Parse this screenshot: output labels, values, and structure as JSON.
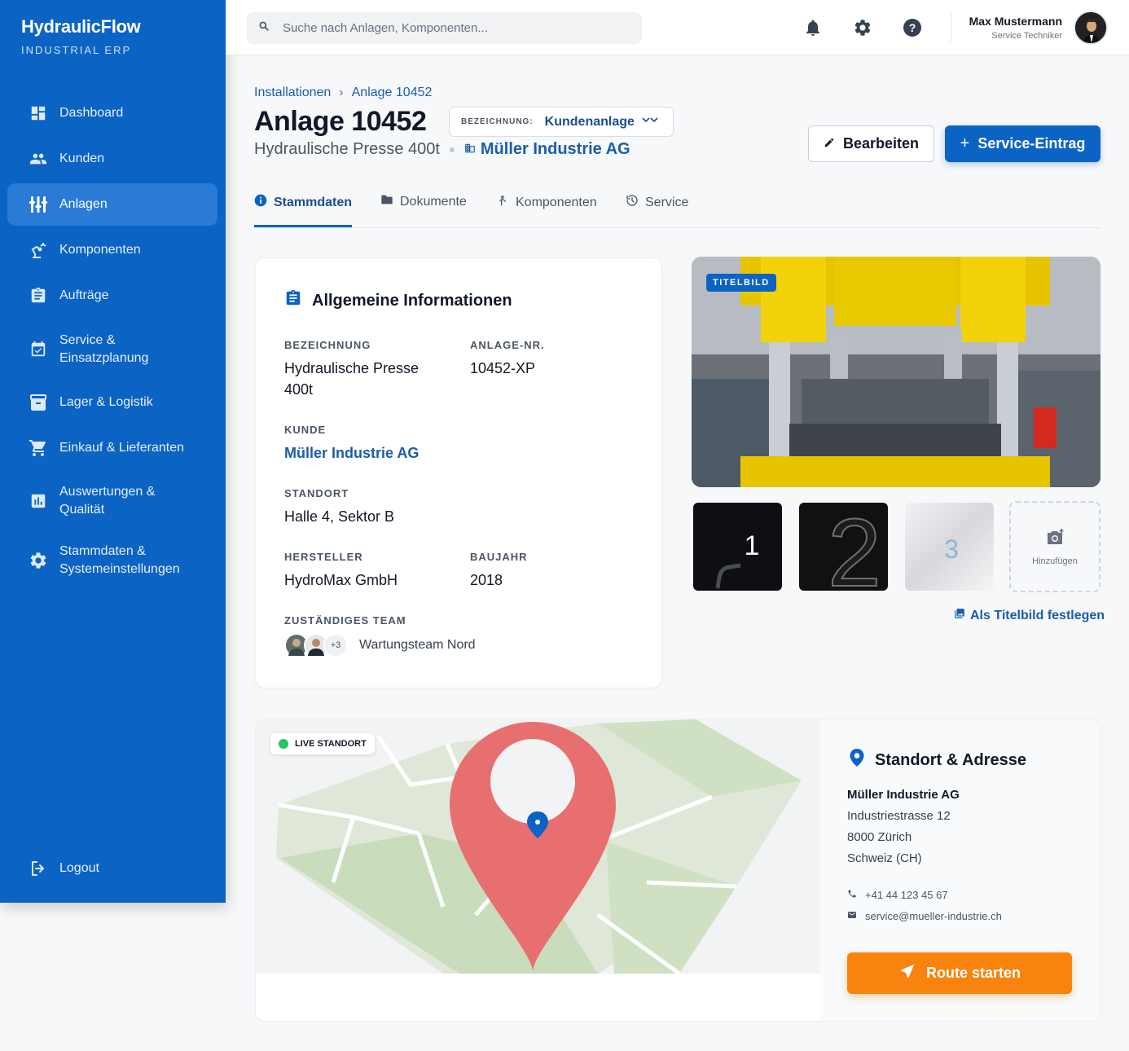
{
  "app": {
    "brand": "HydraulicFlow",
    "brand_sub": "INDUSTRIAL ERP"
  },
  "colors": {
    "primary": "#0b63c4",
    "accent": "#f9830f",
    "live": "#22c55e"
  },
  "sidebar": {
    "items": [
      {
        "label": "Dashboard",
        "icon": "dashboard-icon"
      },
      {
        "label": "Kunden",
        "icon": "users-icon"
      },
      {
        "label": "Anlagen",
        "icon": "equalizer-icon",
        "active": true
      },
      {
        "label": "Komponenten",
        "icon": "robot-arm-icon"
      },
      {
        "label": "Aufträge",
        "icon": "clipboard-icon"
      },
      {
        "label": "Service & Einsatzplanung",
        "icon": "calendar-check-icon"
      },
      {
        "label": "Lager & Logistik",
        "icon": "archive-icon"
      },
      {
        "label": "Einkauf & Lieferanten",
        "icon": "cart-icon"
      },
      {
        "label": "Auswertungen & Qualität",
        "icon": "chart-icon"
      },
      {
        "label": "Stammdaten & Systemeinstellungen",
        "icon": "gear-icon"
      }
    ],
    "logout": "Logout"
  },
  "topbar": {
    "search_placeholder": "Suche nach Anlagen, Komponenten...",
    "user_name": "Max Mustermann",
    "user_role": "Service Techniker"
  },
  "header": {
    "breadcrumb": [
      "Installationen",
      "Anlage 10452"
    ],
    "title": "Anlage 10452",
    "designation_label": "BEZEICHNUNG:",
    "designation_value": "Kundenanlage",
    "subtitle": "Hydraulische Presse 400t",
    "customer": "Müller Industrie AG",
    "edit_label": "Bearbeiten",
    "primary_label": "Service-Eintrag"
  },
  "tabs": [
    {
      "label": "Stammdaten",
      "active": true
    },
    {
      "label": "Dokumente"
    },
    {
      "label": "Komponenten"
    },
    {
      "label": "Service"
    }
  ],
  "general": {
    "title": "Allgemeine Informationen",
    "bezeichnung_label": "BEZEICHNUNG",
    "bezeichnung_value": "Hydraulische Presse 400t",
    "anlagenr_label": "ANLAGE-NR.",
    "anlagenr_value": "10452-XP",
    "kunde_label": "KUNDE",
    "kunde_value": "Müller Industrie AG",
    "standort_label": "STANDORT",
    "standort_value": "Halle 4, Sektor B",
    "hersteller_label": "HERSTELLER",
    "hersteller_value": "HydroMax GmbH",
    "baujahr_label": "BAUJAHR",
    "baujahr_value": "2018",
    "team_label": "ZUSTÄNDIGES TEAM",
    "team_more": "+3",
    "team_name": "Wartungsteam Nord"
  },
  "gallery": {
    "badge": "TITELBILD",
    "thumbs": [
      "1",
      "2",
      "3"
    ],
    "add_label": "Hinzufügen",
    "set_title": "Als Titelbild festlegen"
  },
  "location": {
    "live_label": "LIVE STANDORT",
    "title": "Standort & Adresse",
    "company": "Müller Industrie AG",
    "street": "Industriestrasse 12",
    "city": "8000 Zürich",
    "country": "Schweiz (CH)",
    "phone": "+41 44 123 45 67",
    "email": "service@mueller-industrie.ch",
    "route_label": "Route starten"
  }
}
